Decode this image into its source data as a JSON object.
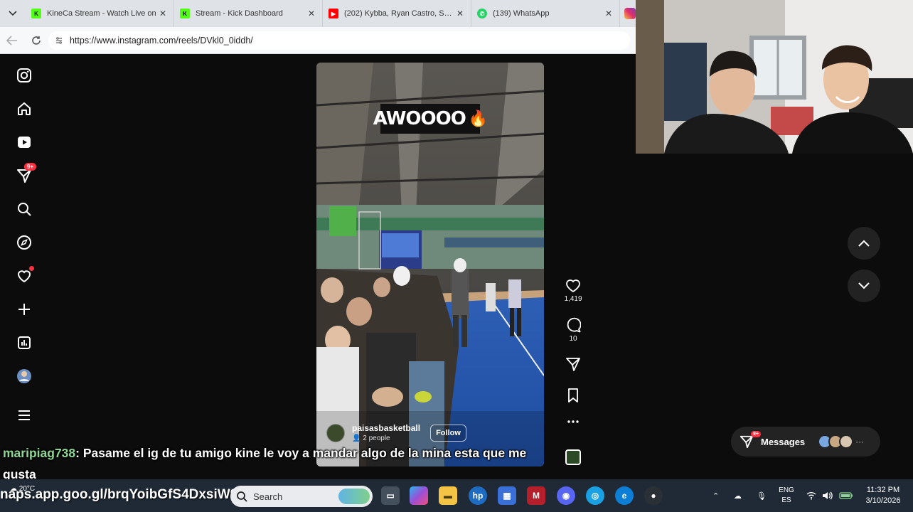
{
  "browser": {
    "tabs": [
      {
        "title": "KineCa Stream - Watch Live on",
        "favicon": "kick-icon",
        "color": "#53fc18"
      },
      {
        "title": "Stream - Kick Dashboard",
        "favicon": "kick-icon",
        "color": "#53fc18"
      },
      {
        "title": "(202) Kybba, Ryan Castro, Sean",
        "favicon": "youtube-icon",
        "color": "#ff0000"
      },
      {
        "title": "(139) WhatsApp",
        "favicon": "whatsapp-icon",
        "color": "#25d366"
      }
    ],
    "url": "https://www.instagram.com/reels/DVkl0_0iddh/"
  },
  "sidebar": {
    "notifications_badge": "9+"
  },
  "reel": {
    "banner_text": "AWOOOO",
    "account_name": "paisasbasketball",
    "people_label": "2 people",
    "follow_label": "Follow",
    "likes": "1,419",
    "comments": "10"
  },
  "messages": {
    "label": "Messages",
    "badge": "9+"
  },
  "chat": {
    "username": "maripiag738",
    "message": ": Pasame el ig de tu amigo kine le voy a mandar algo de la mina esta que me gusta"
  },
  "overlay_link": "naps.app.goo.gl/brqYoibGfS4DxsiW9",
  "taskbar": {
    "weather": "20°C",
    "search_placeholder": "Search",
    "lang_line1": "ENG",
    "lang_line2": "ES",
    "time": "11:32 PM",
    "date": "3/10/2026"
  },
  "colors": {
    "instagram_bg": "#0c0c0c",
    "badge_red": "#ff3040",
    "chat_username": "#8fd694",
    "taskbar": "#1f2a36"
  }
}
